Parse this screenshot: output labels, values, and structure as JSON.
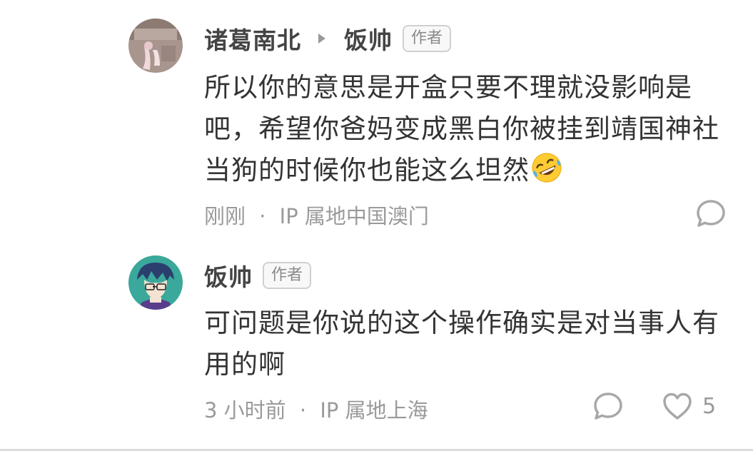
{
  "comments": [
    {
      "author": "诸葛南北",
      "reply_to": "饭帅",
      "reply_to_badge": "作者",
      "text": "所以你的意思是开盒只要不理就没影响是吧，希望你爸妈变成黑白你被挂到靖国神社当狗的时候你也能这么坦然",
      "emoji": "rolling-on-floor-laughing-emoji",
      "time": "刚刚",
      "location": "IP 属地中国澳门"
    },
    {
      "author": "饭帅",
      "author_badge": "作者",
      "text": "可问题是你说的这个操作确实是对当事人有用的啊",
      "time": "3 小时前",
      "location": "IP 属地上海",
      "like_count": "5"
    }
  ],
  "meta_separator": "·",
  "icons": {
    "reply": "comment-bubble-icon",
    "like": "heart-icon"
  },
  "colors": {
    "text": "#333333",
    "meta": "#9a9a9a",
    "badge_border": "#d0d0d0"
  }
}
